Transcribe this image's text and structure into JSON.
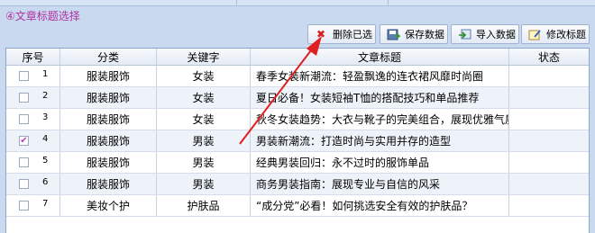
{
  "panel": {
    "icon_glyph": "4",
    "title": "④文章标题选择"
  },
  "toolbar": {
    "delete_selected": "删除已选",
    "save_data": "保存数据",
    "import_data": "导入数据",
    "modify_title": "修改标题"
  },
  "table": {
    "headers": [
      "序号",
      "分类",
      "关键字",
      "文章标题",
      "状态"
    ],
    "rows": [
      {
        "no": "1",
        "category": "服装服饰",
        "keyword": "女装",
        "title": "春季女装新潮流：轻盈飘逸的连衣裙风靡时尚圈",
        "status": "",
        "checked": false
      },
      {
        "no": "2",
        "category": "服装服饰",
        "keyword": "女装",
        "title": "夏日必备！女装短袖T恤的搭配技巧和单品推荐",
        "status": "",
        "checked": false
      },
      {
        "no": "3",
        "category": "服装服饰",
        "keyword": "女装",
        "title": "秋冬女装趋势：大衣与靴子的完美组合，展现优雅气质",
        "status": "",
        "checked": false
      },
      {
        "no": "4",
        "category": "服装服饰",
        "keyword": "男装",
        "title": "男装新潮流：打造时尚与实用并存的造型",
        "status": "",
        "checked": true
      },
      {
        "no": "5",
        "category": "服装服饰",
        "keyword": "男装",
        "title": "经典男装回归：永不过时的服饰单品",
        "status": "",
        "checked": false
      },
      {
        "no": "6",
        "category": "服装服饰",
        "keyword": "男装",
        "title": "商务男装指南：展现专业与自信的风采",
        "status": "",
        "checked": false
      },
      {
        "no": "7",
        "category": "美妆个护",
        "keyword": "护肤品",
        "title": "“成分党”必看！如何挑选安全有效的护肤品？",
        "status": "",
        "checked": false
      }
    ]
  },
  "annotation": {
    "arrow_color": "#e02020"
  }
}
